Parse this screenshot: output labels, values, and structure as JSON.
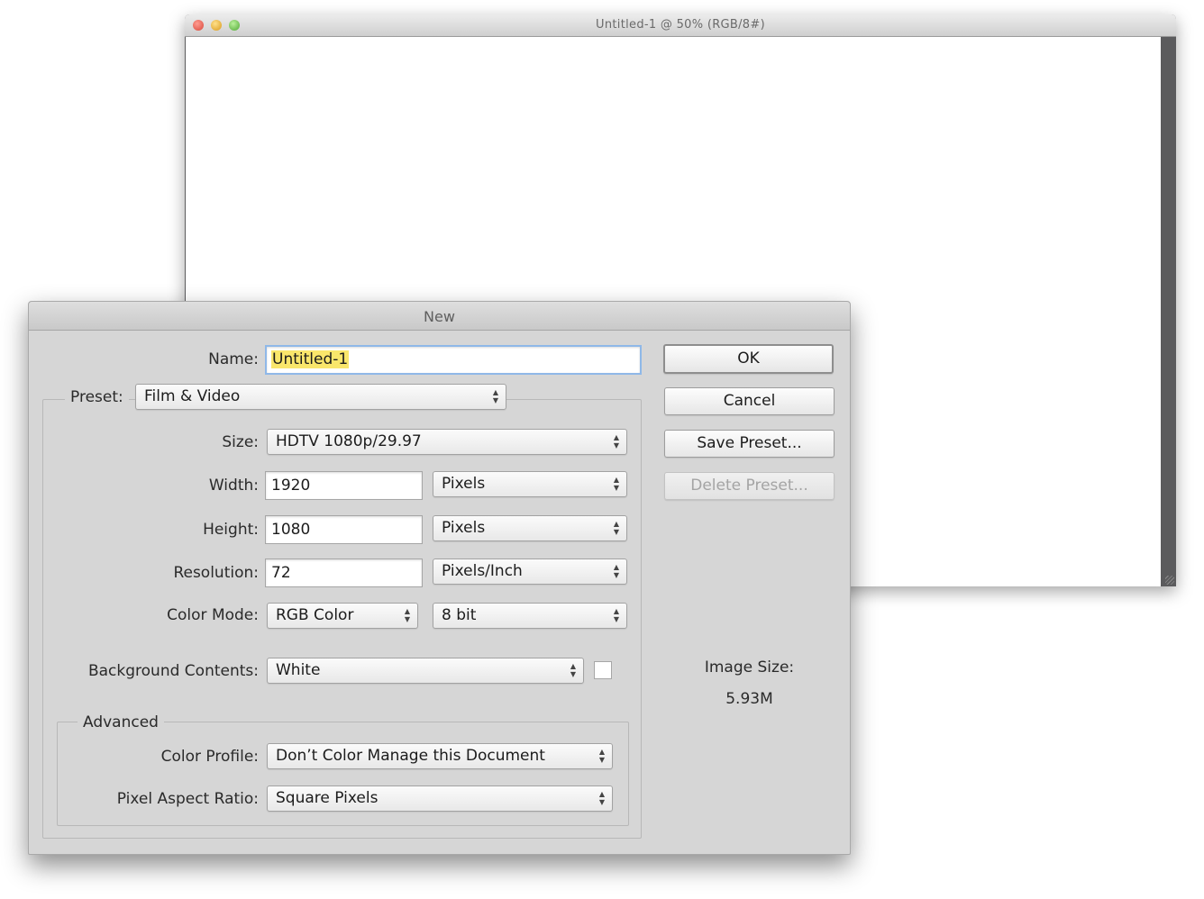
{
  "document_window": {
    "title": "Untitled-1 @ 50% (RGB/8#)"
  },
  "dialog": {
    "title": "New",
    "name_label": "Name:",
    "name_value": "Untitled-1",
    "preset_label": "Preset:",
    "preset_value": "Film & Video",
    "size_label": "Size:",
    "size_value": "HDTV 1080p/29.97",
    "width_label": "Width:",
    "width_value": "1920",
    "width_unit": "Pixels",
    "height_label": "Height:",
    "height_value": "1080",
    "height_unit": "Pixels",
    "resolution_label": "Resolution:",
    "resolution_value": "72",
    "resolution_unit": "Pixels/Inch",
    "color_mode_label": "Color Mode:",
    "color_mode_value": "RGB Color",
    "bit_depth_value": "8 bit",
    "background_label": "Background Contents:",
    "background_value": "White",
    "advanced_label": "Advanced",
    "color_profile_label": "Color Profile:",
    "color_profile_value": "Don’t Color Manage this Document",
    "pixel_aspect_label": "Pixel Aspect Ratio:",
    "pixel_aspect_value": "Square Pixels",
    "image_size_label": "Image Size:",
    "image_size_value": "5.93M",
    "buttons": {
      "ok": "OK",
      "cancel": "Cancel",
      "save_preset": "Save Preset...",
      "delete_preset": "Delete Preset..."
    },
    "background_swatch_color": "#ffffff",
    "name_highlight_color": "#f9e66b"
  }
}
